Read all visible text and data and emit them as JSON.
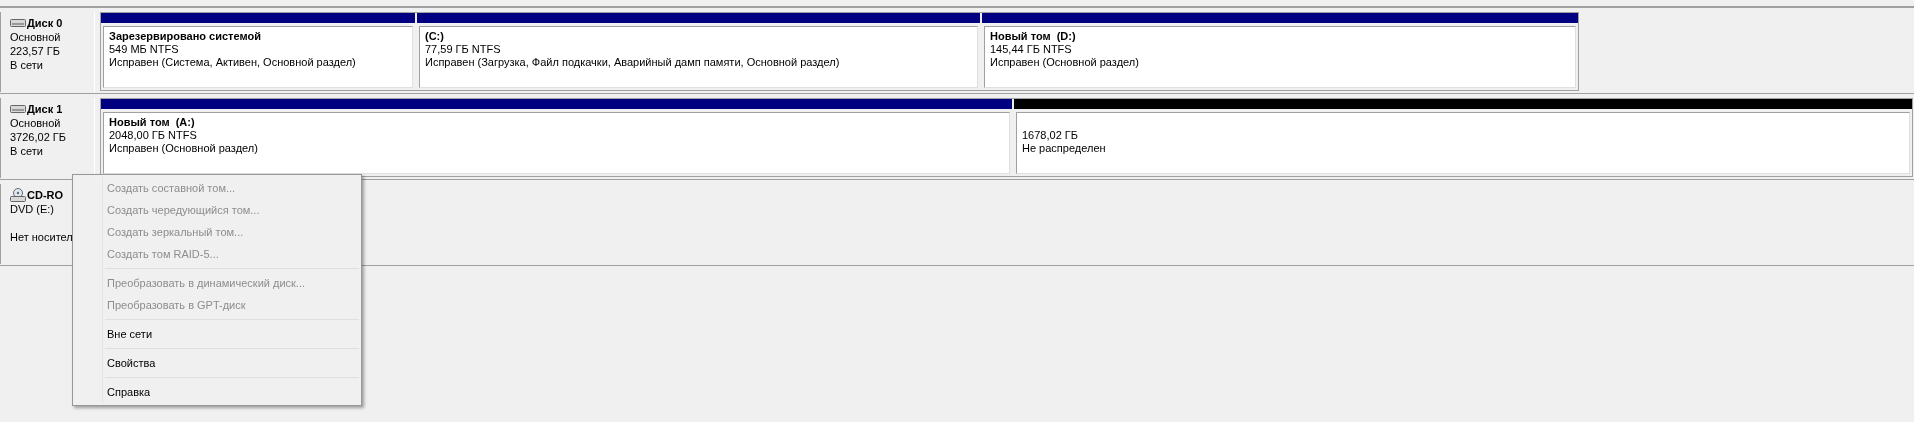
{
  "disks": [
    {
      "kind": "disk",
      "name": "Диск 0",
      "type": "Основной",
      "size": "223,57 ГБ",
      "status": "В сети",
      "partitions": [
        {
          "kind": "primary",
          "title": "Зарезервировано системой",
          "size": "549 МБ NTFS",
          "status": "Исправен (Система, Активен, Основной раздел)"
        },
        {
          "kind": "primary",
          "title": "(C:)",
          "size": "77,59 ГБ NTFS",
          "status": "Исправен (Загрузка, Файл подкачки, Аварийный дамп памяти, Основной раздел)"
        },
        {
          "kind": "primary",
          "title": "Новый том  (D:)",
          "size": "145,44 ГБ NTFS",
          "status": "Исправен (Основной раздел)"
        }
      ]
    },
    {
      "kind": "disk",
      "name": "Диск 1",
      "type": "Основной",
      "size": "3726,02 ГБ",
      "status": "В сети",
      "partitions": [
        {
          "kind": "primary",
          "title": "Новый том  (A:)",
          "size": "2048,00 ГБ NTFS",
          "status": "Исправен (Основной раздел)"
        },
        {
          "kind": "unallocated",
          "size": "1678,02 ГБ",
          "status": "Не распределен"
        }
      ]
    },
    {
      "kind": "cdrom",
      "name": "CD-RO",
      "type": "DVD (E:)",
      "status": "Нет носител"
    }
  ],
  "context_menu": [
    [
      {
        "label": "Создать составной том...",
        "disabled": true
      },
      {
        "label": "Создать чередующийся том...",
        "disabled": true
      },
      {
        "label": "Создать зеркальный том...",
        "disabled": true
      },
      {
        "label": "Создать том RAID-5...",
        "disabled": true
      }
    ],
    [
      {
        "label": "Преобразовать в динамический диск...",
        "disabled": true
      },
      {
        "label": "Преобразовать в GPT-диск",
        "disabled": true
      }
    ],
    [
      {
        "label": "Вне сети",
        "disabled": false
      }
    ],
    [
      {
        "label": "Свойства",
        "disabled": false
      }
    ],
    [
      {
        "label": "Справка",
        "disabled": false
      }
    ]
  ]
}
